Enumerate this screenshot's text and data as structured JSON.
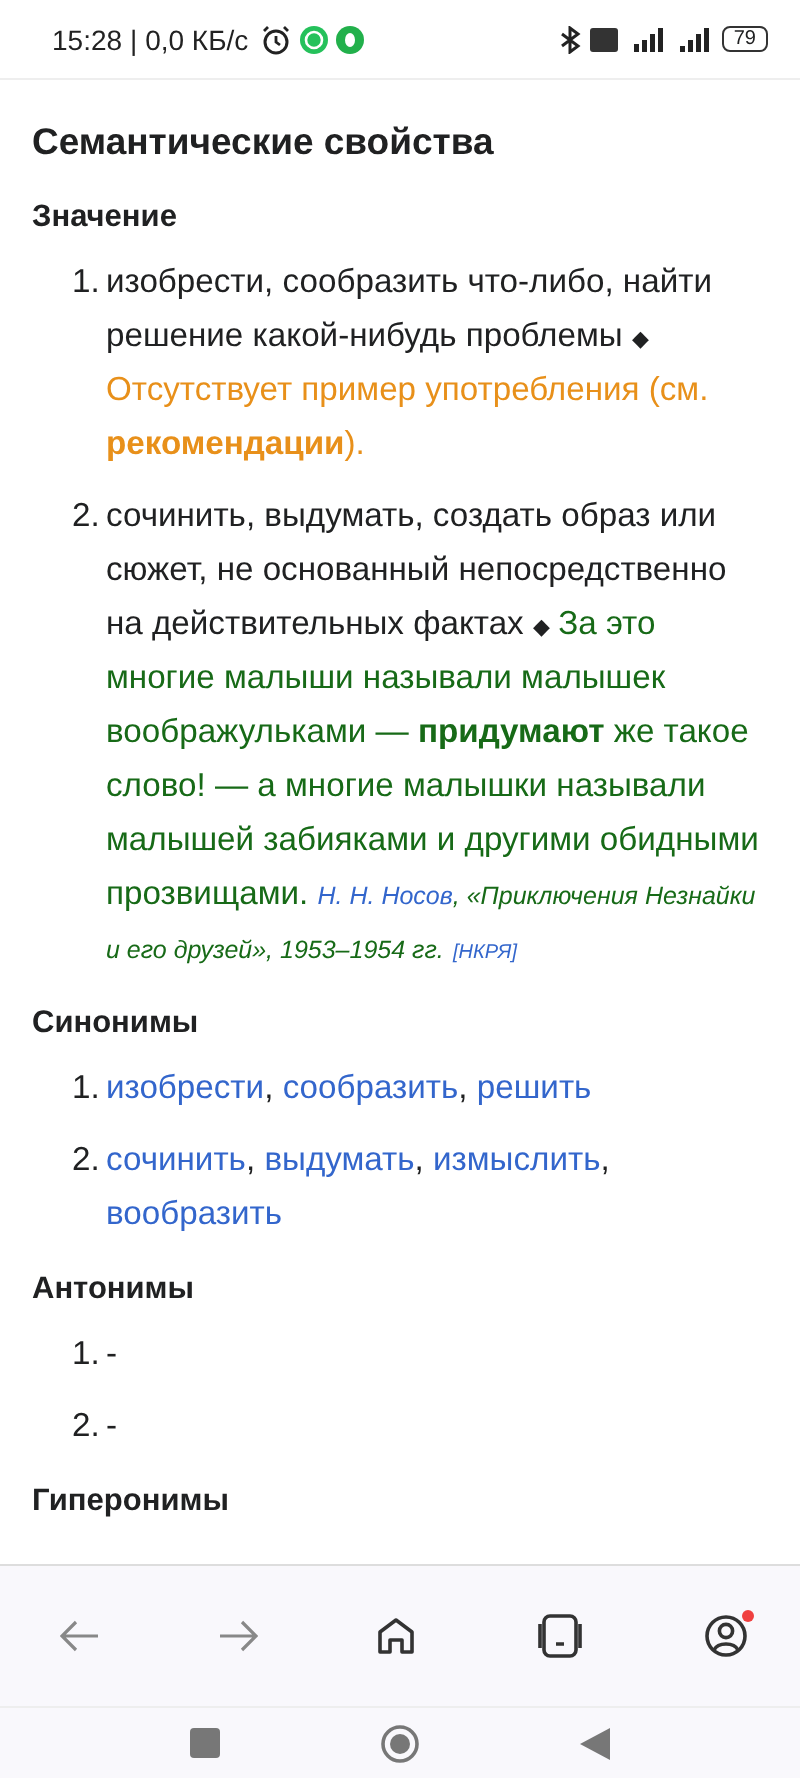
{
  "status_bar": {
    "time": "15:28",
    "speed": "| 0,0 КБ/с",
    "battery": "79"
  },
  "title": "Семантические свойства",
  "sections": [
    {
      "heading": "Значение",
      "kind": "definitions",
      "items": [
        {
          "number": "1.",
          "text": "изобрести, сообразить что-либо, найти решение какой-нибудь проблемы",
          "marker": "◆",
          "example": {
            "kind": "missing",
            "before": "Отсутствует пример употребления (см. ",
            "link": "рекомендации",
            "after": ")."
          }
        },
        {
          "number": "2.",
          "text": "сочинить, выдумать, создать образ или сюжет, не основанный непосредственно на действительных фактах",
          "marker": "◆",
          "example": {
            "kind": "quote",
            "text": "За это многие малыши называли малышек воображульками — **придумают** же такое слово! — а многие малышки называли малышей забияками и другими обидными прозвищами.",
            "author": "Н. Н. Носов",
            "work": ", «Приключения Незнайки и его друзей», 1953–1954 гг.",
            "source": "[НКРЯ]"
          }
        }
      ]
    },
    {
      "heading": "Синонимы",
      "kind": "links",
      "separator": ",",
      "items": [
        {
          "number": "1.",
          "links": [
            "изобрести",
            "сообразить",
            "решить"
          ]
        },
        {
          "number": "2.",
          "links": [
            "сочинить",
            "выдумать",
            "измыслить",
            "вообразить"
          ]
        }
      ]
    },
    {
      "heading": "Антонимы",
      "kind": "plain",
      "items": [
        {
          "number": "1.",
          "text": "-"
        },
        {
          "number": "2.",
          "text": "-"
        }
      ]
    },
    {
      "heading": "Гиперонимы"
    }
  ],
  "notification_dot": true
}
